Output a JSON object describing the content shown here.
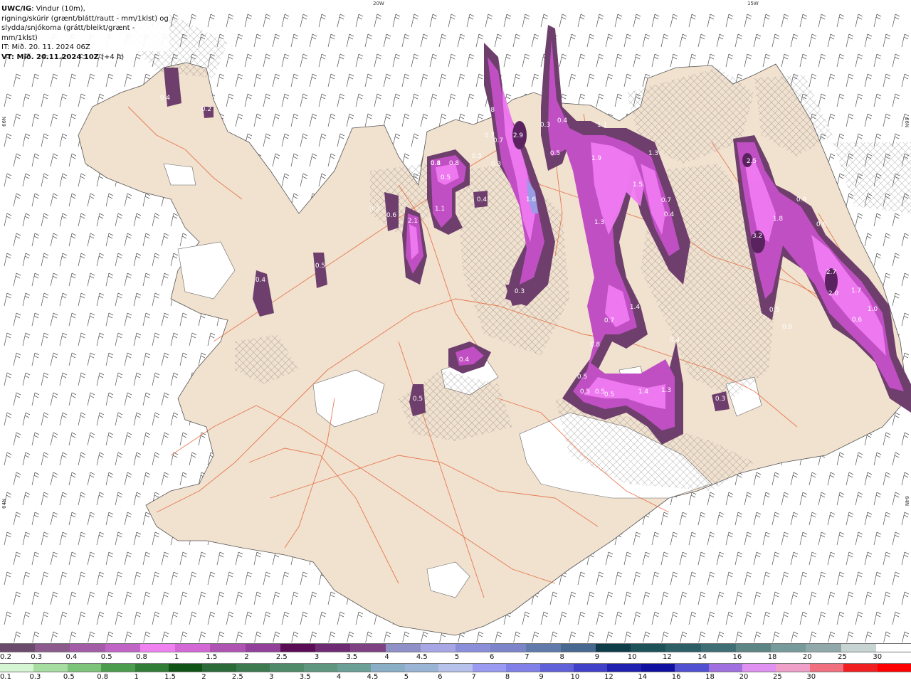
{
  "info": {
    "line1_bold": "UWC/IG",
    "line1_rest": ": Vindur (10m),",
    "line2": "rigning/skúrir (grænt/blátt/rautt - mm/1klst) og",
    "line3": "slydda/snjókoma (grátt/bleikt/grænt - mm/1klst)",
    "line4": "IT: Mið. 20. 11. 2024 06Z",
    "line5_bold": "VT: Mið. 20.11.2024 10Z",
    "line5_rest": " (+4 h)"
  },
  "graticule": {
    "top_20w": "20W",
    "top_15w": "15W",
    "left_66n": "66N",
    "right_66n": "66N",
    "left_64n": "64N",
    "right_64n": "64N"
  },
  "precip_values": [
    "0.4",
    "0.2",
    "0.4",
    "0.8",
    "2.9",
    "0.3",
    "0.4",
    "1.1",
    "0.5",
    "0.7",
    "0.8",
    "0.8",
    "0.5",
    "0.5",
    "0.3",
    "0.4",
    "1.9",
    "1.3",
    "1.5",
    "1.6",
    "0.3",
    "0.6",
    "2.1",
    "1.1",
    "0.4",
    "0.5",
    "0.7",
    "0.7",
    "1.3",
    "0.4",
    "1.4",
    "0.7",
    "0.8",
    "0.4",
    "0.5",
    "0.5",
    "0.5",
    "1.4",
    "1.3",
    "0.4",
    "0.5",
    "0.3",
    "0.3",
    "2.5",
    "0.9",
    "1.8",
    "3.2",
    "0.6",
    "2.7",
    "2.0",
    "1.7",
    "1.0",
    "0.5",
    "0.6",
    "0.8",
    "0.4",
    "0.5"
  ],
  "colors": {
    "land": "#f1e1cf",
    "road": "#e4673a",
    "precip_outer": "#6e3f6c",
    "precip_mid": "#c04fc3",
    "precip_inner": "#f07af2",
    "precip_core": "#5a2360",
    "ice": "#ffffff"
  },
  "legend": {
    "snow_colors": [
      "#6b4a6b",
      "#8d5a8d",
      "#a35ca6",
      "#c065c6",
      "#ef82f0",
      "#d468d6",
      "#b054b4",
      "#93409a",
      "#5a0c55",
      "#6e2b73",
      "#7e4282",
      "#9090c8",
      "#a7a7e6",
      "#8b8fd9",
      "#7c85c9",
      "#5f7aab",
      "#476890",
      "#0e3c48",
      "#1d5258",
      "#2c5f66",
      "#3f6e75",
      "#5c8585",
      "#779b9b",
      "#91a9ab",
      "#c7d4d2",
      "#ffffff"
    ],
    "snow_labels": [
      "0.2",
      "0.3",
      "0.4",
      "0.5",
      "0.8",
      "1",
      "1.5",
      "2",
      "2.5",
      "3",
      "3.5",
      "4",
      "4.5",
      "5",
      "6",
      "7",
      "8",
      "9",
      "10",
      "12",
      "14",
      "16",
      "18",
      "20",
      "25",
      "30"
    ],
    "rain_colors": [
      "#d6f5d3",
      "#a6dda1",
      "#7cc47a",
      "#4c9c4e",
      "#2f7d36",
      "#0f5417",
      "#2b6b3a",
      "#3d7a50",
      "#4f8a6a",
      "#5e9680",
      "#6aa095",
      "#8aaec6",
      "#9ab4d6",
      "#b6c2ec",
      "#9a9af3",
      "#8080e8",
      "#6060d8",
      "#4040c8",
      "#2020b0",
      "#1010a0",
      "#5050d0",
      "#a070e0",
      "#e090f0",
      "#f0a0c8",
      "#f07080",
      "#f02020",
      "#ff0000"
    ],
    "rain_labels": [
      "0.1",
      "0.3",
      "0.5",
      "0.8",
      "1",
      "1.5",
      "2",
      "2.5",
      "3",
      "3.5",
      "4",
      "4.5",
      "5",
      "6",
      "7",
      "8",
      "9",
      "10",
      "12",
      "14",
      "16",
      "18",
      "20",
      "25",
      "30"
    ]
  }
}
